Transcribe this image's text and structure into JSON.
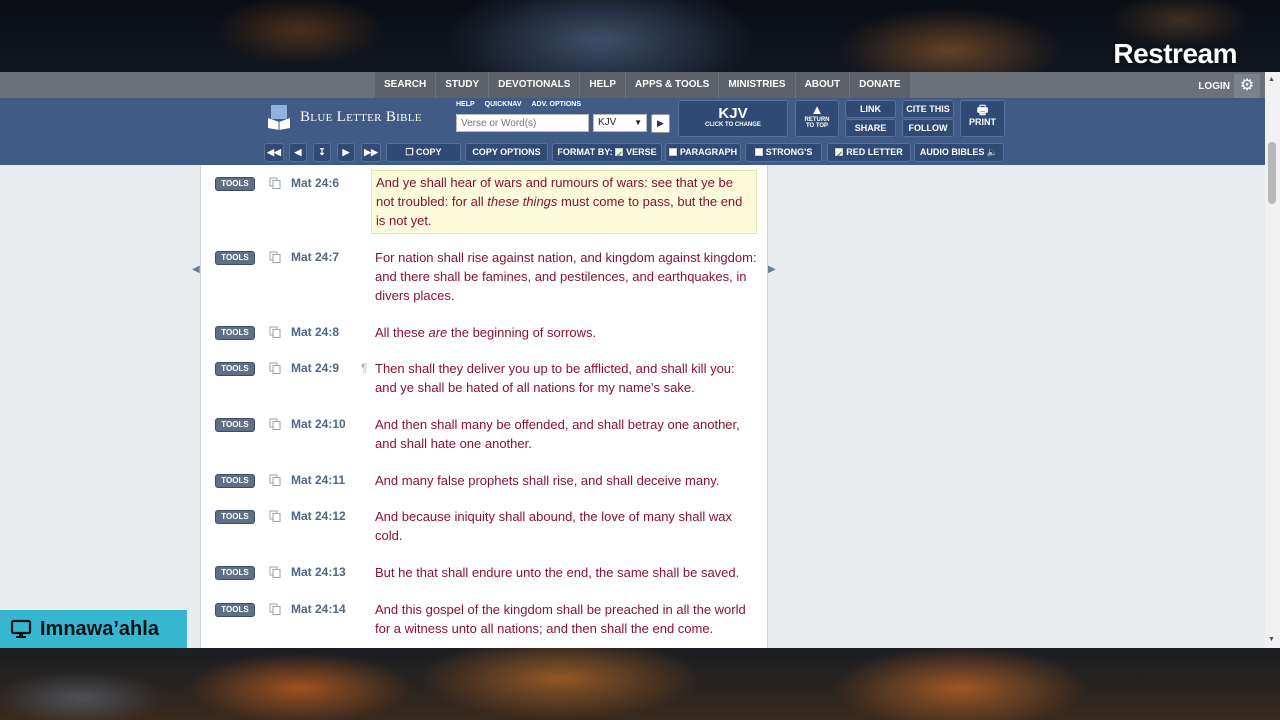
{
  "overlay": {
    "brand": "Restream",
    "streamer_name": "Imnawa’ahla"
  },
  "topnav": {
    "links": [
      "SEARCH",
      "STUDY",
      "DEVOTIONALS",
      "HELP",
      "APPS & TOOLS",
      "MINISTRIES",
      "ABOUT",
      "DONATE"
    ],
    "login": "LOGIN"
  },
  "header": {
    "site_name": "Blue Letter Bible",
    "mini_links": [
      "HELP",
      "QUICKNAV",
      "ADV. OPTIONS"
    ],
    "search_placeholder": "Verse or Word(s)",
    "version_selected": "KJV",
    "kjv_label": "KJV",
    "kjv_sub": "CLICK TO CHANGE",
    "return_top_1": "RETURN",
    "return_top_2": "TO TOP",
    "link": "LINK",
    "share": "SHARE",
    "cite": "CITE THIS",
    "follow": "FOLLOW",
    "print": "PRINT"
  },
  "toolbar": {
    "copy": "COPY",
    "copy_options": "COPY OPTIONS",
    "format_by": "FORMAT BY:",
    "verse": "VERSE",
    "paragraph": "PARAGRAPH",
    "strongs": "STRONG'S",
    "red_letter": "RED LETTER",
    "audio_bibles": "AUDIO BIBLES",
    "verse_checked": true,
    "paragraph_checked": false,
    "strongs_checked": false,
    "red_letter_checked": true
  },
  "tools_label": "TOOLS",
  "verses": [
    {
      "ref": "Mat 24:6",
      "pre": "And ye shall hear of wars and rumours of wars: see that ye be not troubled: for all ",
      "em": "these things",
      "post": " must come to pass, but the end is not yet.",
      "highlighted": true,
      "pilcrow": false
    },
    {
      "ref": "Mat 24:7",
      "pre": "For nation shall rise against nation, and kingdom against kingdom: and there shall be famines, and pestilences, and earthquakes, in divers places.",
      "em": "",
      "post": "",
      "highlighted": false,
      "pilcrow": false
    },
    {
      "ref": "Mat 24:8",
      "pre": "All these ",
      "em": "are",
      "post": " the beginning of sorrows.",
      "highlighted": false,
      "pilcrow": false
    },
    {
      "ref": "Mat 24:9",
      "pre": "Then shall they deliver you up to be afflicted, and shall kill you: and ye shall be hated of all nations for my name's sake.",
      "em": "",
      "post": "",
      "highlighted": false,
      "pilcrow": true
    },
    {
      "ref": "Mat 24:10",
      "pre": "And then shall many be offended, and shall betray one another, and shall hate one another.",
      "em": "",
      "post": "",
      "highlighted": false,
      "pilcrow": false
    },
    {
      "ref": "Mat 24:11",
      "pre": "And many false prophets shall rise, and shall deceive many.",
      "em": "",
      "post": "",
      "highlighted": false,
      "pilcrow": false
    },
    {
      "ref": "Mat 24:12",
      "pre": "And because iniquity shall abound, the love of many shall wax cold.",
      "em": "",
      "post": "",
      "highlighted": false,
      "pilcrow": false
    },
    {
      "ref": "Mat 24:13",
      "pre": "But he that shall endure unto the end, the same shall be saved.",
      "em": "",
      "post": "",
      "highlighted": false,
      "pilcrow": false
    },
    {
      "ref": "Mat 24:14",
      "pre": "And this gospel of the kingdom shall be preached in all the world for a witness unto all nations; and then shall the end come.",
      "em": "",
      "post": "",
      "highlighted": false,
      "pilcrow": false
    }
  ],
  "pilcrow_char": "¶"
}
